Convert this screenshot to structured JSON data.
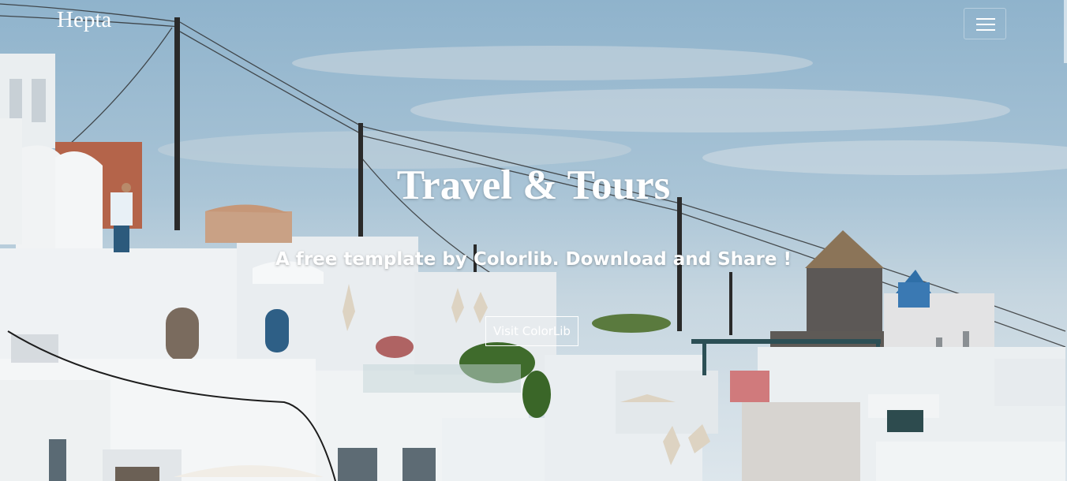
{
  "navbar": {
    "brand": "Hepta",
    "menu_icon": "hamburger-menu-icon"
  },
  "hero": {
    "title": "Travel & Tours",
    "subtitle": "A free template by Colorlib. Download and Share !",
    "cta_label": "Visit ColorLib"
  },
  "colors": {
    "sky": "#a9c4d6",
    "buildings": "#eef2f4",
    "text": "#ffffff"
  }
}
